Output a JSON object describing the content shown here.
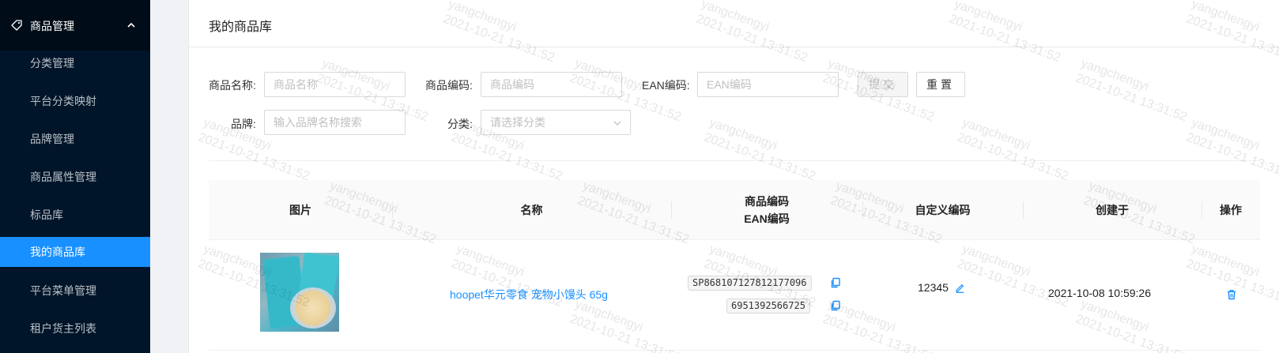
{
  "sidebar": {
    "group": {
      "label": "商品管理",
      "icon": "tag-icon"
    },
    "items": [
      {
        "label": "分类管理",
        "active": false
      },
      {
        "label": "平台分类映射",
        "active": false
      },
      {
        "label": "品牌管理",
        "active": false
      },
      {
        "label": "商品属性管理",
        "active": false
      },
      {
        "label": "标品库",
        "active": false
      },
      {
        "label": "我的商品库",
        "active": true
      },
      {
        "label": "平台菜单管理",
        "active": false
      },
      {
        "label": "租户货主列表",
        "active": false
      }
    ]
  },
  "page": {
    "title": "我的商品库"
  },
  "filters": {
    "name": {
      "label": "商品名称:",
      "placeholder": "商品名称"
    },
    "code": {
      "label": "商品编码:",
      "placeholder": "商品编码"
    },
    "ean": {
      "label": "EAN编码:",
      "placeholder": "EAN编码"
    },
    "brand": {
      "label": "品牌:",
      "placeholder": "输入品牌名称搜索"
    },
    "category": {
      "label": "分类:",
      "placeholder": "请选择分类"
    },
    "submit_label": "提交",
    "reset_label": "重置"
  },
  "table": {
    "headers": {
      "image": "图片",
      "name": "名称",
      "code": "商品编码",
      "ean": "EAN编码",
      "custom": "自定义编码",
      "created": "创建于",
      "action": "操作"
    },
    "rows": [
      {
        "name": "hoopet华元零食 宠物小馒头 65g",
        "code": "SP868107127812177096",
        "ean": "6951392566725",
        "custom_code": "12345",
        "created": "2021-10-08 10:59:26"
      }
    ]
  },
  "watermark": {
    "user": "yangchengyi",
    "time": "2021-10-21 13:31:52"
  },
  "colors": {
    "sidebar_bg": "#001529",
    "accent": "#1890ff"
  }
}
